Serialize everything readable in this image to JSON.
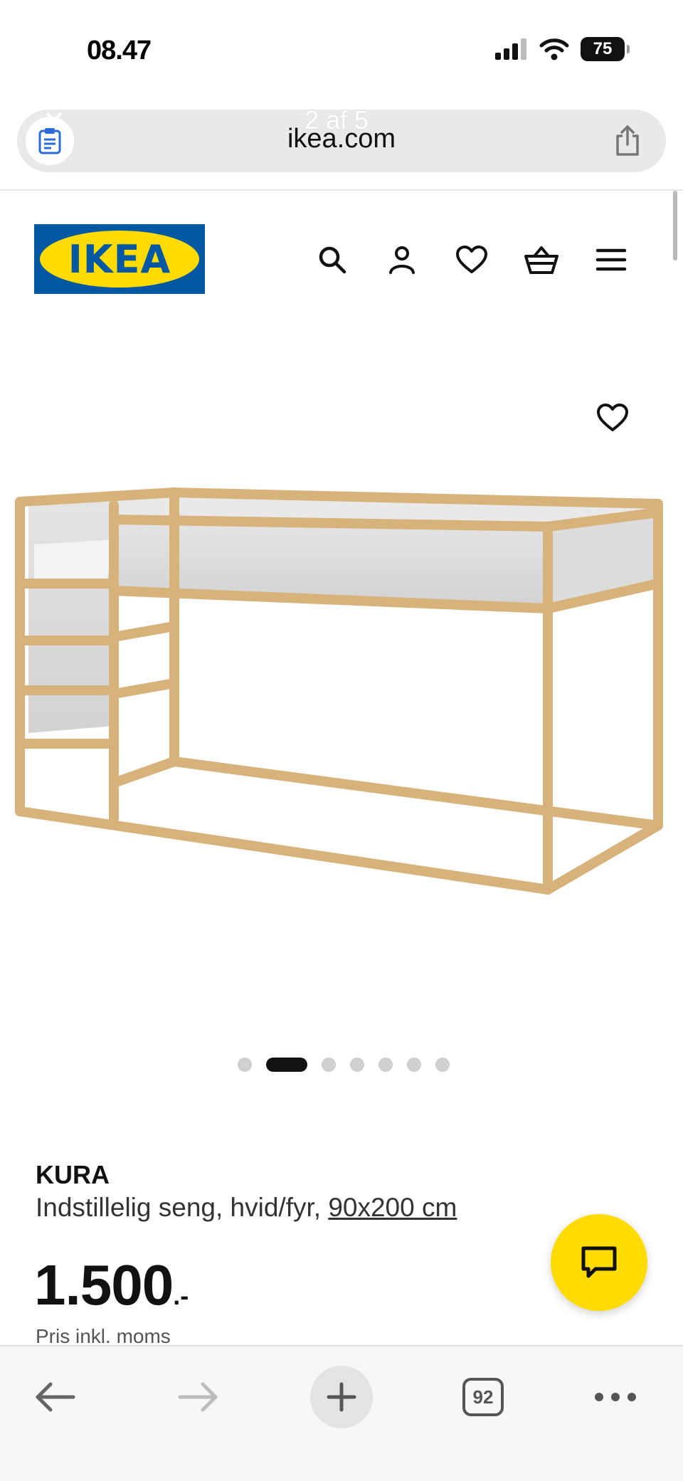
{
  "status_bar": {
    "time": "08.47",
    "battery": "75"
  },
  "browser": {
    "url": "ikea.com",
    "page_counter": "2 af 5",
    "close_glyph": "✕",
    "tabs_count": "92"
  },
  "header": {
    "logo_text": "IKEA",
    "icons": [
      "search-icon",
      "account-icon",
      "favorites-icon",
      "basket-icon",
      "menu-icon"
    ]
  },
  "gallery": {
    "total_images": 7,
    "active_index": 1
  },
  "product": {
    "name": "KURA",
    "description": "Indstillelig seng, hvid/fyr, ",
    "size": "90x200 cm",
    "price": "1.500",
    "price_suffix": ".-",
    "price_note": "Pris inkl. moms"
  },
  "colors": {
    "ikea_blue": "#0058a3",
    "ikea_yellow": "#ffdb00"
  }
}
